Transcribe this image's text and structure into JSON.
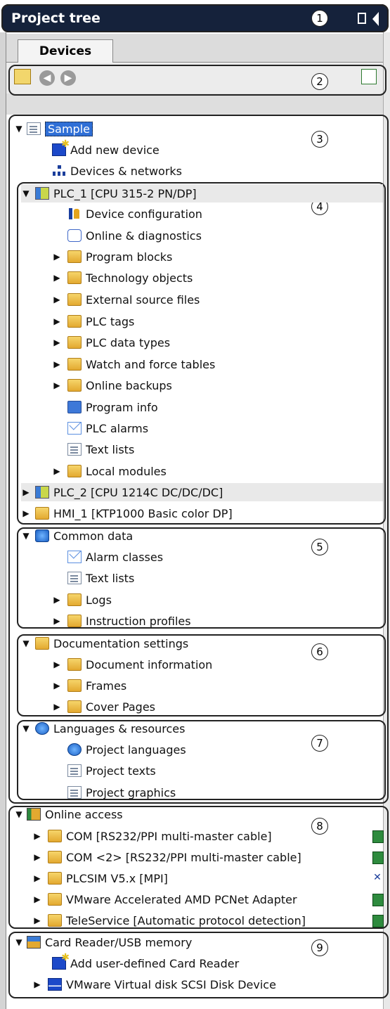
{
  "header": {
    "title": "Project tree"
  },
  "tabs": {
    "active": "Devices"
  },
  "callouts": [
    "1",
    "2",
    "3",
    "4",
    "5",
    "6",
    "7",
    "8",
    "9"
  ],
  "tree": {
    "project": "Sample",
    "add_new_device": "Add new device",
    "devices_networks": "Devices & networks",
    "plc1": "PLC_1 [CPU 315-2 PN/DP]",
    "plc1_items": [
      "Device configuration",
      "Online & diagnostics",
      "Program blocks",
      "Technology objects",
      "External source files",
      "PLC tags",
      "PLC data types",
      "Watch and force tables",
      "Online backups",
      "Program info",
      "PLC alarms",
      "Text lists",
      "Local modules"
    ],
    "plc2": "PLC_2 [CPU 1214C DC/DC/DC]",
    "hmi1": "HMI_1 [KTP1000 Basic color DP]",
    "common_data": "Common data",
    "common_items": [
      "Alarm classes",
      "Text lists",
      "Logs",
      "Instruction profiles"
    ],
    "doc_settings": "Documentation settings",
    "doc_items": [
      "Document information",
      "Frames",
      "Cover Pages"
    ],
    "languages": "Languages & resources",
    "lang_items": [
      "Project languages",
      "Project texts",
      "Project graphics"
    ],
    "online_access": "Online access",
    "online_items": [
      "COM [RS232/PPI multi-master cable]",
      "COM <2> [RS232/PPI multi-master cable]",
      "PLCSIM V5.x [MPI]",
      "VMware Accelerated AMD PCNet Adapter",
      "TeleService [Automatic protocol detection]"
    ],
    "card_reader": "Card Reader/USB memory",
    "card_items": [
      "Add user-defined Card Reader",
      "VMware Virtual disk SCSI Disk Device"
    ]
  }
}
